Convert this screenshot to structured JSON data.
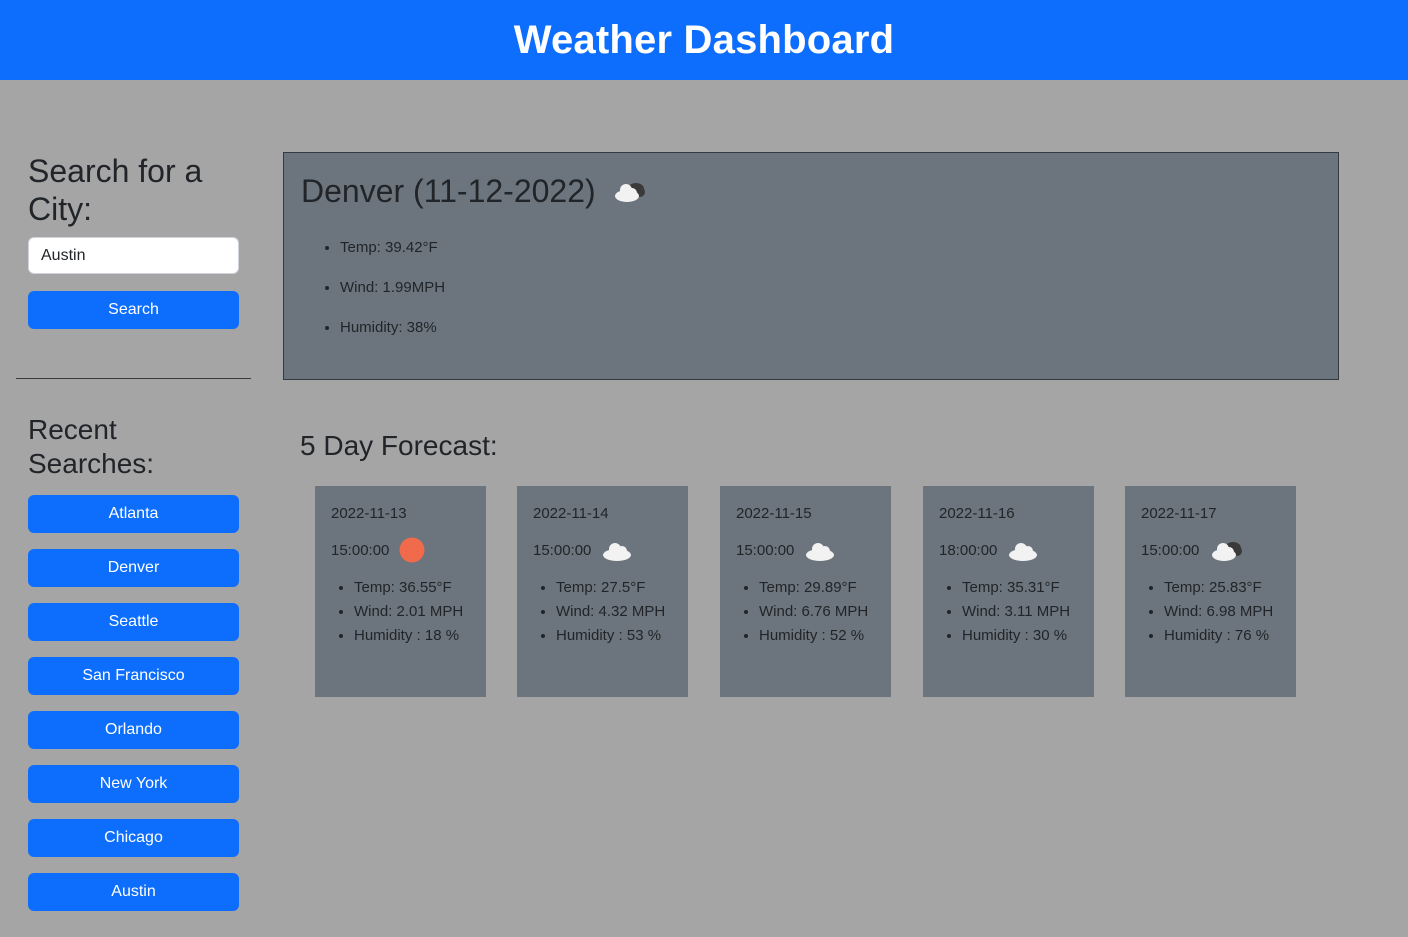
{
  "app": {
    "title": "Weather Dashboard"
  },
  "sidebar": {
    "search_heading": "Search for a City:",
    "input_value": "Austin",
    "search_button": "Search",
    "recent_heading": "Recent Searches:",
    "recent": [
      "Atlanta",
      "Denver",
      "Seattle",
      "San Francisco",
      "Orlando",
      "New York",
      "Chicago",
      "Austin"
    ]
  },
  "current": {
    "title": "Denver (11-12-2022)",
    "icon": "broken-clouds-icon",
    "temp": "Temp: 39.42°F",
    "wind": "Wind: 1.99MPH",
    "humidity": "Humidity: 38%"
  },
  "forecast": {
    "heading": "5 Day Forecast:",
    "days": [
      {
        "date": "2022-11-13",
        "time": "15:00:00",
        "icon": "sun-icon",
        "temp": "Temp: 36.55°F",
        "wind": "Wind: 2.01 MPH",
        "humidity": "Humidity : 18 %"
      },
      {
        "date": "2022-11-14",
        "time": "15:00:00",
        "icon": "cloud-icon",
        "temp": "Temp: 27.5°F",
        "wind": "Wind: 4.32 MPH",
        "humidity": "Humidity : 53 %"
      },
      {
        "date": "2022-11-15",
        "time": "15:00:00",
        "icon": "cloud-icon",
        "temp": "Temp: 29.89°F",
        "wind": "Wind: 6.76 MPH",
        "humidity": "Humidity : 52 %"
      },
      {
        "date": "2022-11-16",
        "time": "18:00:00",
        "icon": "cloud-icon",
        "temp": "Temp: 35.31°F",
        "wind": "Wind: 3.11 MPH",
        "humidity": "Humidity : 30 %"
      },
      {
        "date": "2022-11-17",
        "time": "15:00:00",
        "icon": "broken-clouds-icon",
        "temp": "Temp: 25.83°F",
        "wind": "Wind: 6.98 MPH",
        "humidity": "Humidity : 76 %"
      }
    ]
  },
  "colors": {
    "header": "#0d6efd",
    "background": "#a5a5a5",
    "card": "#6c757d",
    "sun": "#f06a4b"
  }
}
